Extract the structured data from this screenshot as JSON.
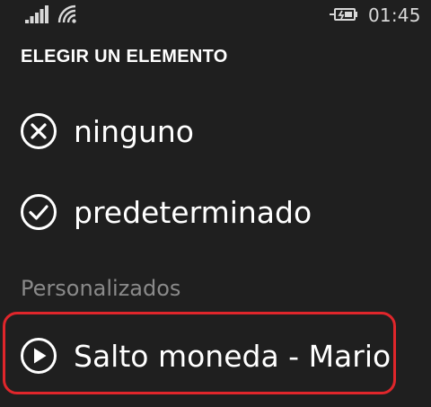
{
  "status_bar": {
    "time": "01:45",
    "icons": [
      "signal-icon",
      "wifi-icon",
      "battery-charging-icon"
    ]
  },
  "header": {
    "title": "ELEGIR UN ELEMENTO"
  },
  "options": [
    {
      "label": "ninguno",
      "icon": "close-circle-icon"
    },
    {
      "label": "predeterminado",
      "icon": "check-circle-icon"
    }
  ],
  "custom_section": {
    "label": "Personalizados",
    "items": [
      {
        "label": "Salto moneda - Mario",
        "icon": "play-circle-icon"
      }
    ]
  },
  "colors": {
    "background": "#1f1f1f",
    "text": "#ffffff",
    "muted": "#8a8a8a",
    "highlight": "#e0262b"
  }
}
